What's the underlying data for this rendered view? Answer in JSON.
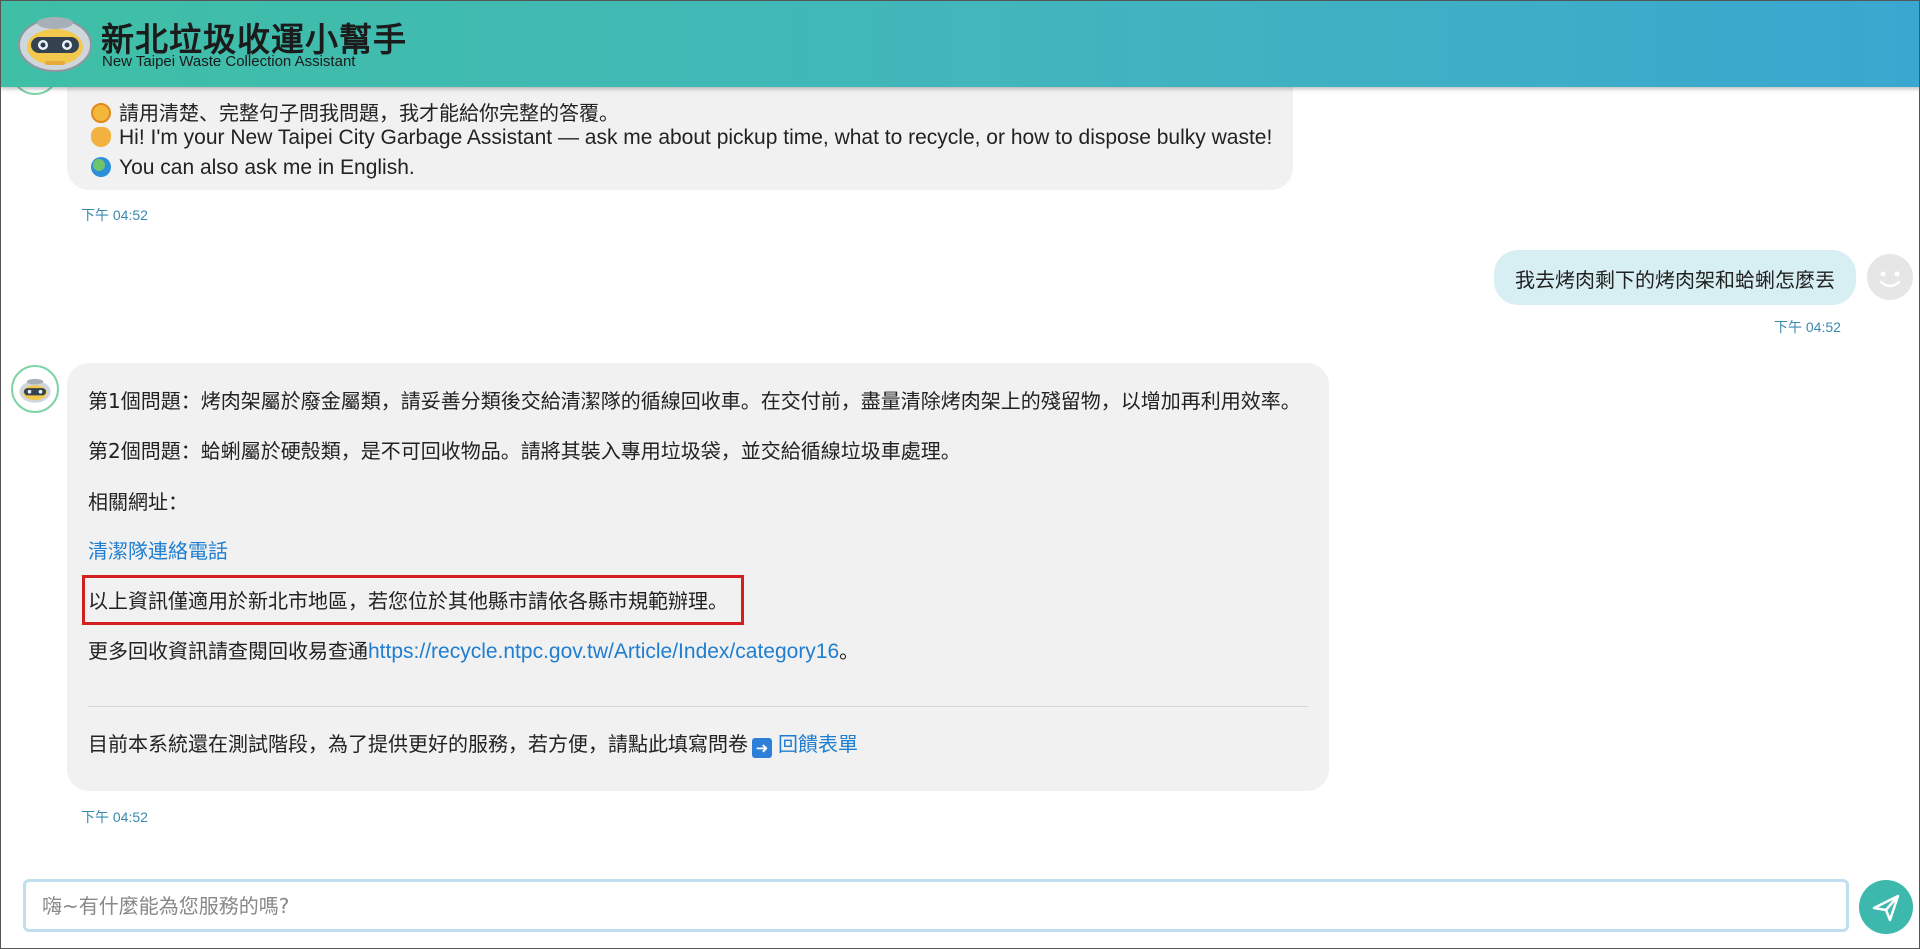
{
  "header": {
    "title_cn": "新北垃圾收運小幫手",
    "title_en": "New Taipei Waste Collection Assistant"
  },
  "messages": {
    "intro": {
      "line1": "請用清楚、完整句子問我問題，我才能給你完整的答覆。",
      "line2": "Hi! I'm your New Taipei City Garbage Assistant — ask me about pickup time, what to recycle, or how to dispose bulky waste!",
      "line3": "You can also ask me in English.",
      "time": "下午 04:52"
    },
    "user": {
      "text": "我去烤肉剩下的烤肉架和蛤蜊怎麼丟",
      "time": "下午 04:52"
    },
    "answer": {
      "q1": "第1個問題：烤肉架屬於廢金屬類，請妥善分類後交給清潔隊的循線回收車。在交付前，盡量清除烤肉架上的殘留物，以增加再利用效率。",
      "q2": "第2個問題：蛤蜊屬於硬殼類，是不可回收物品。請將其裝入專用垃圾袋，並交給循線垃圾車處理。",
      "related_label": "相關網址：",
      "related_link": "清潔隊連絡電話",
      "disclaimer": "以上資訊僅適用於新北市地區，若您位於其他縣市請依各縣市規範辦理。",
      "more_prefix": "更多回收資訊請查閱回收易查通",
      "more_url": "https://recycle.ntpc.gov.tw/Article/Index/category16",
      "more_suffix": "。",
      "survey_text": "目前本系統還在測試階段，為了提供更好的服務，若方便，請點此填寫問卷",
      "survey_link": "回饋表單",
      "time": "下午 04:52"
    }
  },
  "input": {
    "placeholder": "嗨~有什麼能為您服務的嗎?"
  },
  "colors": {
    "header_start": "#3fbfa6",
    "header_end": "#3aa7d0",
    "bot_bubble": "#f1f1f1",
    "user_bubble": "#d7eef2",
    "link": "#1f7ed0",
    "highlight": "#d11f1f",
    "send_button": "#3cb8ad"
  },
  "icons": {
    "logo": "robot-mascot-icon",
    "bot_avatar": "robot-avatar-icon",
    "user_avatar": "smiley-avatar-icon",
    "send": "paper-plane-icon"
  }
}
